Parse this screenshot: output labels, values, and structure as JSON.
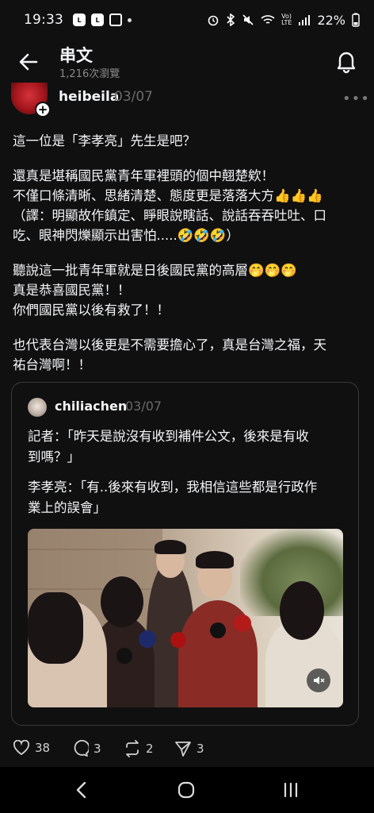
{
  "status_bar": {
    "time": "19:33",
    "battery": "22%",
    "left_icons": [
      "line-icon",
      "line-icon",
      "image-icon",
      "dot-icon"
    ],
    "right_icons": [
      "alarm-icon",
      "bluetooth-icon",
      "mute-icon",
      "wifi-icon",
      "volte-icon",
      "signal-icon",
      "battery-icon"
    ]
  },
  "header": {
    "title": "串文",
    "views": "1,216次瀏覽"
  },
  "post": {
    "username": "heibeila",
    "date": "03/07",
    "paragraphs": [
      [
        "這一位是「李孝亮」先生是吧？"
      ],
      [
        "還真是堪稱國民黨青年軍裡頭的個中翹楚欸！",
        "不僅口條清晰、思緒清楚、態度更是落落大方👍👍👍",
        "（譯：明顯故作鎮定、睜眼說瞎話、說話吞吞吐吐、口",
        "吃、眼神閃爍顯示出害怕.....🤣🤣🤣）"
      ],
      [
        "聽說這一批青年軍就是日後國民黨的高層🤭🤭🤭",
        "真是恭喜國民黨！！",
        "你們國民黨以後有救了！！"
      ],
      [
        "也代表台灣以後更是不需要擔心了，真是台灣之福，天",
        "祐台灣啊！！"
      ]
    ],
    "likes": "38",
    "comments": "3",
    "reposts": "2",
    "shares": "3"
  },
  "quoted": {
    "username": "chiliachen",
    "date": "03/07",
    "paragraphs": [
      [
        "記者：「昨天是說沒有收到補件公文，後來是有收",
        "到嗎？」"
      ],
      [
        "李孝亮：「有..後來有收到，我相信這些都是行政作",
        "業上的誤會」"
      ]
    ],
    "video_muted": true
  },
  "colors": {
    "background": "#101010",
    "text": "#f3f5f7",
    "muted": "#6a6a6a",
    "border": "#3a3a3a"
  }
}
